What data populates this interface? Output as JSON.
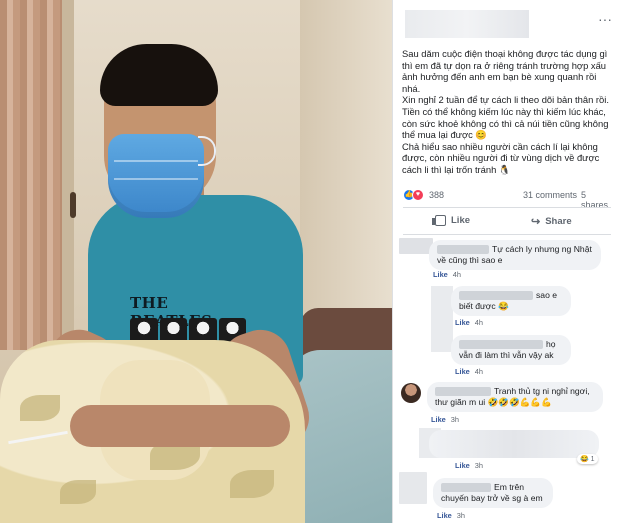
{
  "post": {
    "more_icon": "···",
    "paragraphs": [
      "Sau dăm cuộc điện thoại không được tác dụng gì thì em đã tự dọn ra ở riêng tránh trường hợp xấu ảnh hưởng đến anh em bạn bè xung quanh rồi nhá.",
      "Xin nghỉ 2 tuần để tự cách li theo dõi bản thân rồi. Tiền có thể không kiếm lúc này thì kiếm lúc khác, còn sức khoẻ không có thì cả núi tiền cũng không thể mua lại được 😊",
      "Chả hiểu sao nhiều người cần cách lí lại không được, còn nhiều người đi từ vùng dịch về được cách li thì lại trốn tránh 🐧"
    ],
    "reaction_count": "388",
    "comments_label": "31 comments",
    "shares_label": "5 shares",
    "like_label": "Like",
    "share_label": "Share"
  },
  "comments": [
    {
      "text": "Tự cách ly nhưng ng Nhật về cũng thì sao e",
      "like": "Like",
      "time": "4h"
    },
    {
      "text": "sao e biết được 😂",
      "like": "Like",
      "time": "4h"
    },
    {
      "text": "họ vẫn đi làm thì vẫn vậy ak",
      "like": "Like",
      "time": "4h"
    },
    {
      "text": "Tranh thủ tg ni nghỉ ngơi, thư giãn m ui 🤣🤣🤣💪💪💪",
      "like": "Like",
      "time": "3h"
    },
    {
      "text": "",
      "like": "Like",
      "time": "3h",
      "reaction": "😂 1"
    },
    {
      "text": "Em trên chuyến bay trở về sg à em",
      "like": "Like",
      "time": "3h"
    }
  ],
  "colors": {
    "link": "#385898",
    "bubble": "#f0f2f5",
    "like_blue": "#1877f2",
    "love_red": "#f33e58",
    "muted": "#606770"
  },
  "icons": {
    "like": "thumbs-up-icon",
    "share": "share-arrow-icon",
    "more": "more-options-icon"
  }
}
